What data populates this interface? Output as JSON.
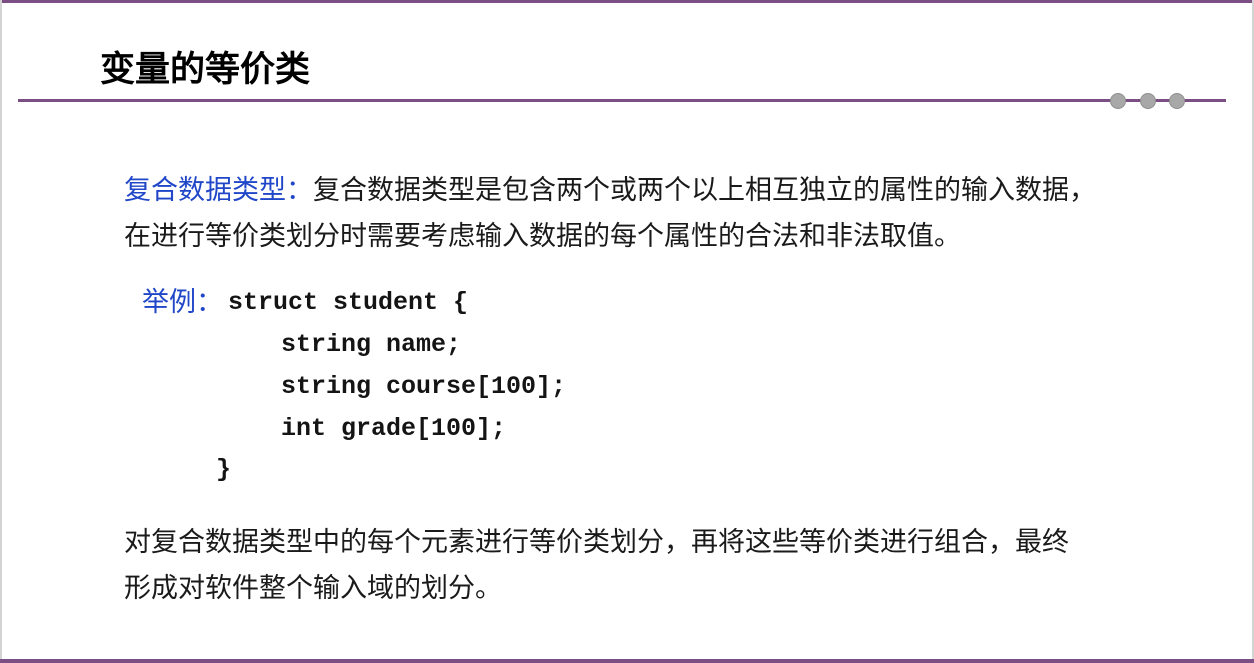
{
  "slide": {
    "title": "变量的等价类",
    "paragraph1": {
      "term": "复合数据类型：",
      "line1_rest": "复合数据类型是包含两个或两个以上相互独立的属性的输入数据，",
      "line2": "在进行等价类划分时需要考虑输入数据的每个属性的合法和非法取值。"
    },
    "example": {
      "label": "举例：",
      "code_lines": [
        "struct student {",
        "string name;",
        "string course[100];",
        "int grade[100];",
        "}"
      ]
    },
    "paragraph2": {
      "line1": "对复合数据类型中的每个元素进行等价类划分，再将这些等价类进行组合，最终",
      "line2": "形成对软件整个输入域的划分。"
    }
  },
  "colors": {
    "accent_rule": "#7b4f84",
    "highlight_text": "#2147c9",
    "dot_gray": "#a8a8a8"
  },
  "icons": {
    "title_ornament": "three-dots-ornament"
  }
}
